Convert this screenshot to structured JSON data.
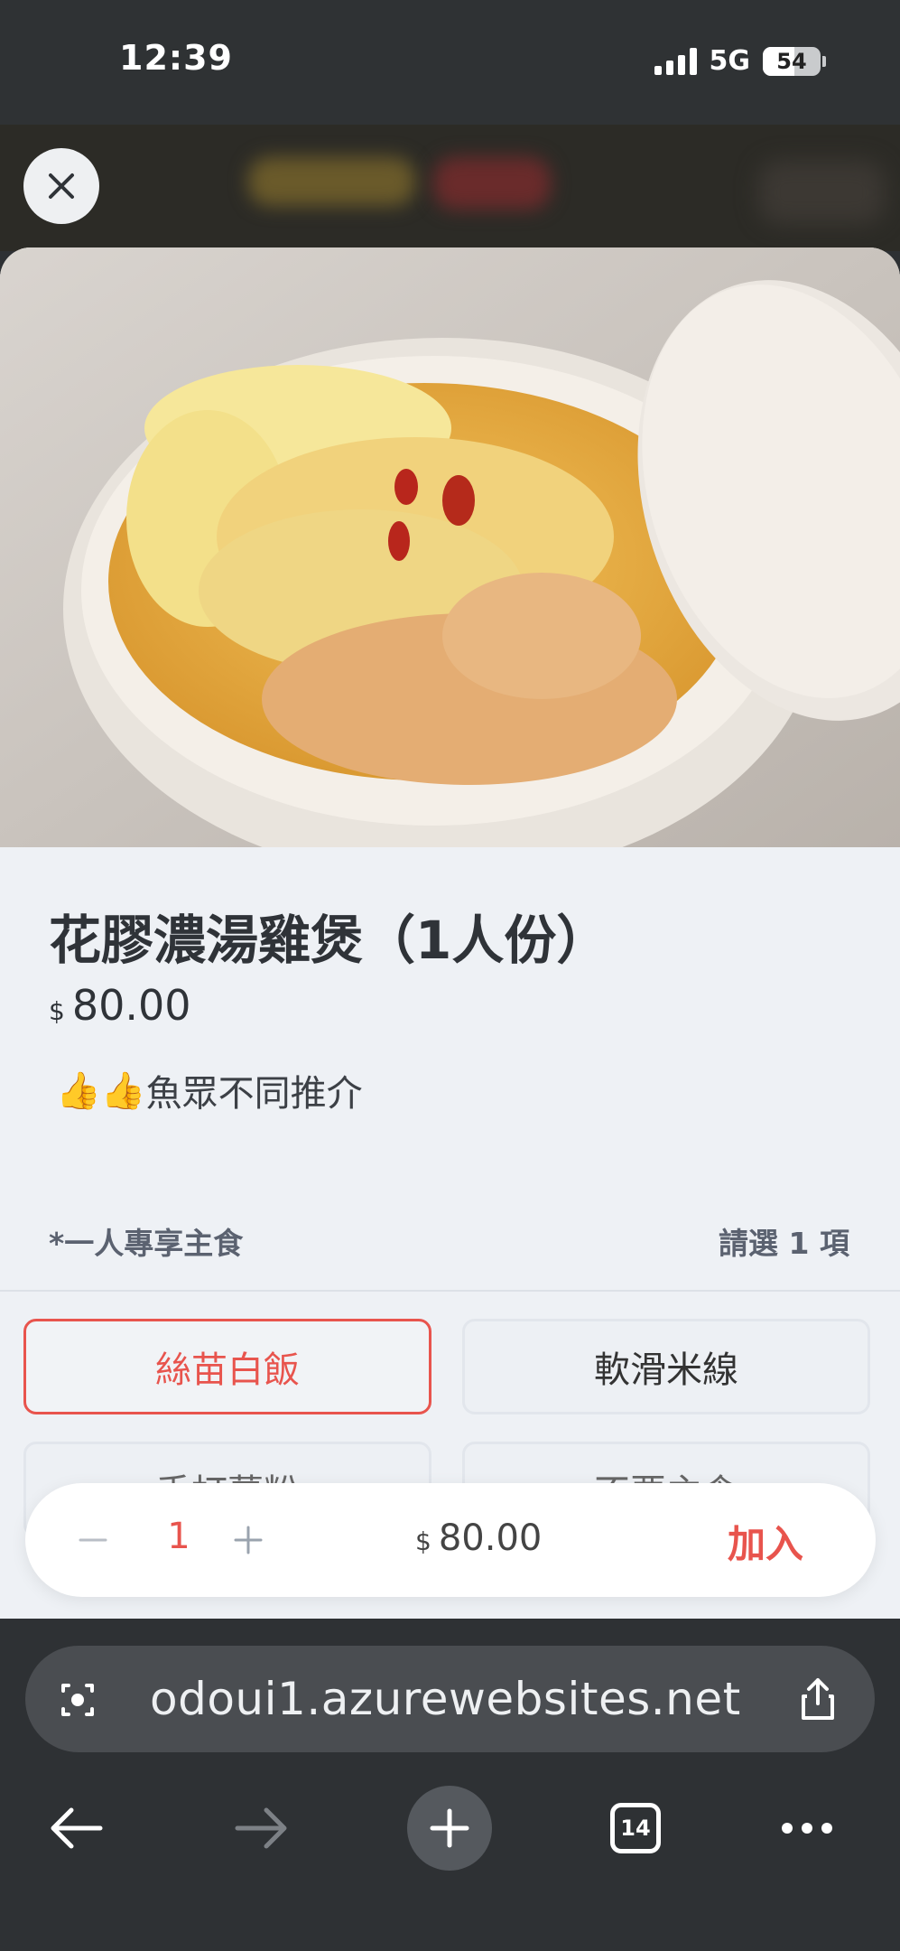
{
  "status_bar": {
    "time": "12:39",
    "network": "5G",
    "battery": "54",
    "battery_level": 0.54
  },
  "item": {
    "title": "花膠濃湯雞煲（1人份）",
    "currency": "$",
    "price": "80.00",
    "description": "魚眾不同推介",
    "description_icons": [
      "thumbs-up-emoji",
      "thumbs-up-emoji"
    ]
  },
  "option_group": {
    "title": "*一人專享主食",
    "rule": "請選 1 項",
    "options": [
      {
        "label": "絲苗白飯",
        "selected": true
      },
      {
        "label": "軟滑米線",
        "selected": false
      },
      {
        "label": "手打薯粉",
        "selected": false
      },
      {
        "label": "不要主食",
        "selected": false
      }
    ]
  },
  "cart_bar": {
    "quantity": "1",
    "currency": "$",
    "total": "80.00",
    "add_label": "加入"
  },
  "browser": {
    "url": "odoui1.azurewebsites.net",
    "tab_count": "14"
  },
  "colors": {
    "accent": "#e8544d",
    "sheet_bg": "#eef1f5",
    "chrome_bg": "#2e3134"
  }
}
